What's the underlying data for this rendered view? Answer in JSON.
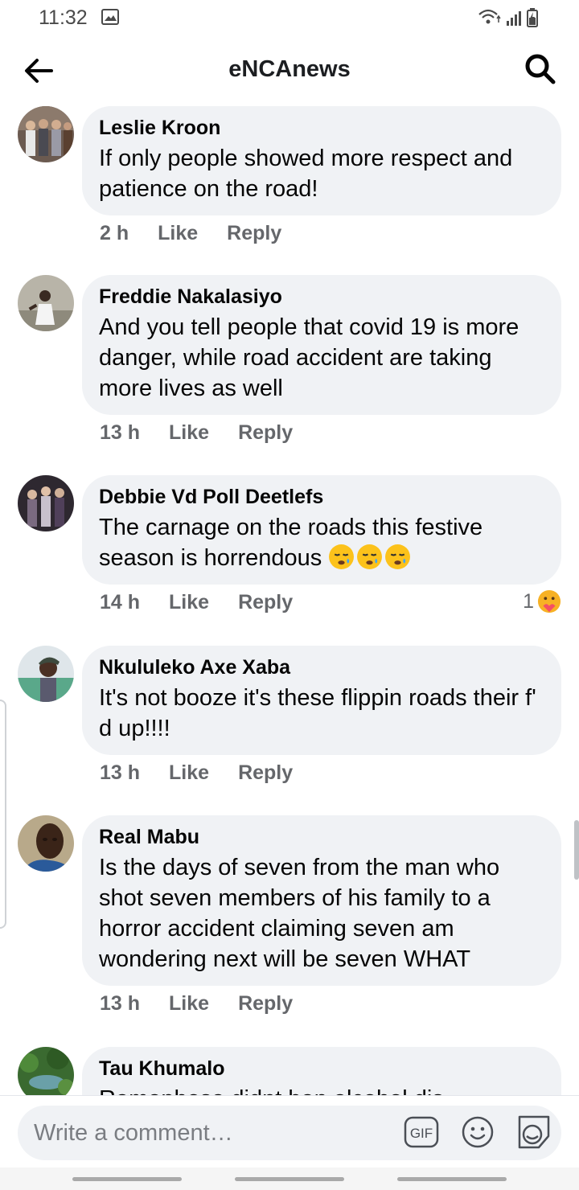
{
  "status_bar": {
    "time": "11:32"
  },
  "header": {
    "title": "eNCAnews"
  },
  "comments": [
    {
      "author": "Leslie Kroon",
      "text": "If only people showed more respect and patience on the road!",
      "time": "2 h",
      "like": "Like",
      "reply": "Reply"
    },
    {
      "author": "Freddie Nakalasiyo",
      "text": "And you tell people that covid 19 is  more danger, while road accident are taking more lives as well",
      "time": "13 h",
      "like": "Like",
      "reply": "Reply"
    },
    {
      "author": "Debbie Vd Poll Deetlefs",
      "text": "The carnage on the roads this festive season is horrendous",
      "emojis": [
        "sleepy-face",
        "sleepy-face",
        "sleepy-face"
      ],
      "time": "14 h",
      "like": "Like",
      "reply": "Reply",
      "reaction_count": "1",
      "reaction_icon": "care-reaction"
    },
    {
      "author": "Nkululeko Axe Xaba",
      "text": "It's not booze it's these flippin roads their f' d up!!!!",
      "time": "13 h",
      "like": "Like",
      "reply": "Reply"
    },
    {
      "author": "Real Mabu",
      "text": "Is the days of seven from the man who shot seven members of his family to a horror accident claiming seven am wondering next will be seven WHAT",
      "time": "13 h",
      "like": "Like",
      "reply": "Reply"
    },
    {
      "author": "Tau Khumalo",
      "text": "Ramaphosa didnt ban alcohol dis"
    }
  ],
  "composer": {
    "placeholder": "Write a comment…",
    "gif_label": "GIF"
  },
  "colors": {
    "bubble": "#f0f2f5",
    "meta": "#65676b",
    "text": "#050505"
  }
}
